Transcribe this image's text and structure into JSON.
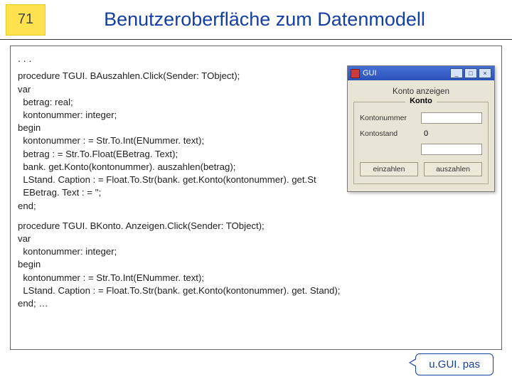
{
  "header": {
    "slide_number": "71",
    "title": "Benutzeroberfläche zum Datenmodell"
  },
  "content": {
    "leading_ellipsis": ". . .",
    "code1": "procedure TGUI. BAuszahlen.Click(Sender: TObject);\nvar\n  betrag: real;\n  kontonummer: integer;\nbegin\n  kontonummer : = Str.To.Int(ENummer. text);\n  betrag : = Str.To.Float(EBetrag. Text);\n  bank. get.Konto(kontonummer). auszahlen(betrag);\n  LStand. Caption : = Float.To.Str(bank. get.Konto(kontonummer). get.St\n  EBetrag. Text : = '';\nend;",
    "code2": "procedure TGUI. BKonto. Anzeigen.Click(Sender: TObject);\nvar\n  kontonummer: integer;\nbegin\n  kontonummer : = Str.To.Int(ENummer. text);\n  LStand. Caption : = Float.To.Str(bank. get.Konto(kontonummer). get. Stand);\nend; …"
  },
  "mini_window": {
    "titlebar_text": "GUI",
    "top_label": "Konto anzeigen",
    "group_legend": "Konto",
    "label_nummer": "Kontonummer",
    "label_stand": "Kontostand",
    "value_stand": "0",
    "btn_einzahlen": "einzahlen",
    "btn_auszahlen": "auszahlen",
    "minimize": "_",
    "maximize": "□",
    "close": "×"
  },
  "callout": {
    "text": "u.GUI. pas"
  }
}
